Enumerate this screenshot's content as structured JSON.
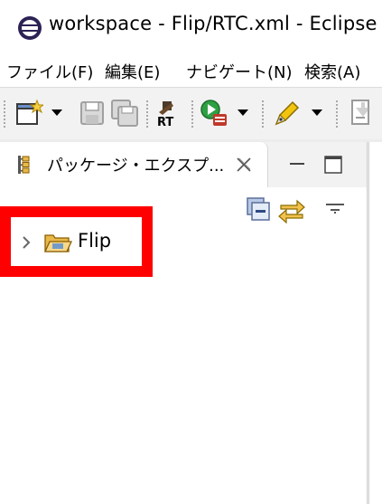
{
  "window": {
    "title": "workspace - Flip/RTC.xml - Eclipse",
    "icon": "eclipse-icon"
  },
  "menubar": {
    "items": [
      "ファイル(F)",
      "編集(E)",
      "ナビゲート(N)",
      "検索(A)"
    ]
  },
  "toolbar": {
    "buttons": [
      "new-icon",
      "save-icon",
      "save-all-icon",
      "rtc-builder-icon",
      "run-icon",
      "pen-tool-icon",
      "import-icon"
    ]
  },
  "panel": {
    "tab_label": "パッケージ・エクスプ...",
    "tab_icon": "package-explorer-icon",
    "close_icon": "close-icon",
    "minimize_icon": "minimize-icon",
    "maximize_icon": "maximize-icon"
  },
  "view_toolbar": {
    "collapse_all": "collapse-all-icon",
    "link_with_editor": "link-with-editor-icon",
    "view_menu": "view-menu-icon"
  },
  "tree": {
    "items": [
      {
        "label": "Flip",
        "icon": "project-folder-icon",
        "expanded": false
      }
    ]
  },
  "colors": {
    "highlight": "#ff0000",
    "toolbar_bg": "#f2f2f2",
    "folder": "#e8b84a"
  }
}
